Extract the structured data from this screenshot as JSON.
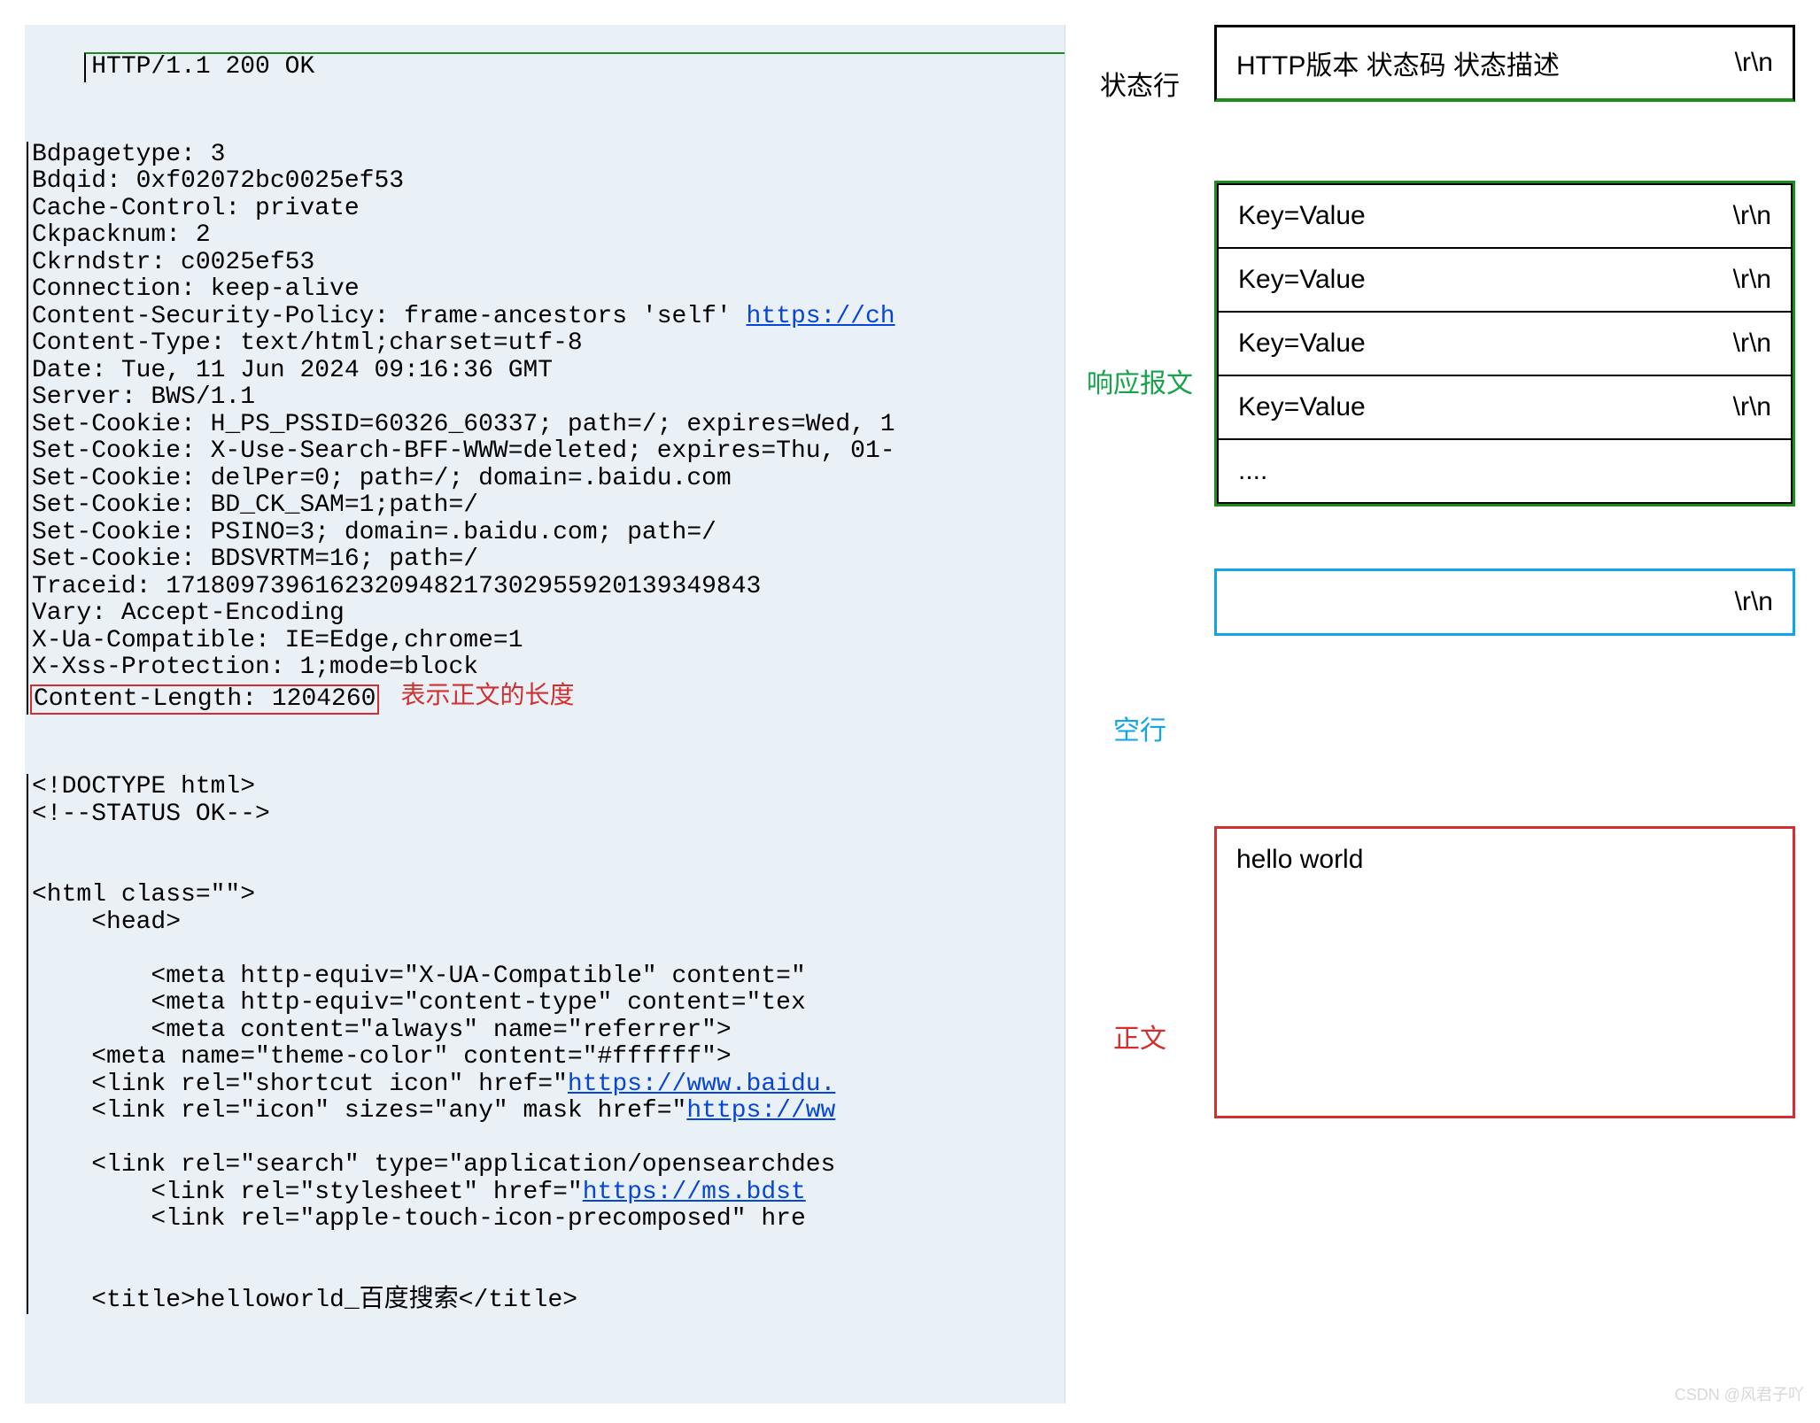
{
  "left": {
    "status_line": "HTTP/1.1 200 OK",
    "headers_pre1": "Bdpagetype: 3\nBdqid: 0xf02072bc0025ef53\nCache-Control: private\nCkpacknum: 2\nCkrndstr: c0025ef53\nConnection: keep-alive\nContent-Security-Policy: frame-ancestors 'self' ",
    "csp_link": "https://ch",
    "headers_pre2": "\nContent-Type: text/html;charset=utf-8\nDate: Tue, 11 Jun 2024 09:16:36 GMT\nServer: BWS/1.1\nSet-Cookie: H_PS_PSSID=60326_60337; path=/; expires=Wed, 1\nSet-Cookie: X-Use-Search-BFF-WWW=deleted; expires=Thu, 01-\nSet-Cookie: delPer=0; path=/; domain=.baidu.com\nSet-Cookie: BD_CK_SAM=1;path=/\nSet-Cookie: PSINO=3; domain=.baidu.com; path=/\nSet-Cookie: BDSVRTM=16; path=/\nTraceid: 1718097396162320948217302955920139349843\nVary: Accept-Encoding\nX-Ua-Compatible: IE=Edge,chrome=1\nX-Xss-Protection: 1;mode=block",
    "content_length": "Content-Length: 1204260",
    "content_length_note": "表示正文的长度",
    "body_pre1": "<!DOCTYPE html>\n<!--STATUS OK-->\n\n\n<html class=\"\">\n    <head>\n\n        <meta http-equiv=\"X-UA-Compatible\" content=\"\n        <meta http-equiv=\"content-type\" content=\"tex\n        <meta content=\"always\" name=\"referrer\">\n    <meta name=\"theme-color\" content=\"#ffffff\">\n    <link rel=\"shortcut icon\" href=\"",
    "link1": "https://www.baidu.",
    "body_pre2": "\n    <link rel=\"icon\" sizes=\"any\" mask href=\"",
    "link2": "https://ww",
    "body_pre3": "\n\n    <link rel=\"search\" type=\"application/opensearchdes\n        <link rel=\"stylesheet\" href=\"",
    "link3": "https://ms.bdst",
    "body_pre4": "\n        <link rel=\"apple-touch-icon-precomposed\" hre\n\n\n    <title>helloworld_百度搜索</title>"
  },
  "mid": {
    "status": "状态行",
    "headers": "响应报文",
    "blank": "空行",
    "body": "正文"
  },
  "right": {
    "status_box": "HTTP版本 状态码 状态描述",
    "crlf": "\\r\\n",
    "kv": "Key=Value",
    "ellipsis": "....",
    "body_text": "hello world"
  },
  "watermark": "CSDN @风君子吖"
}
